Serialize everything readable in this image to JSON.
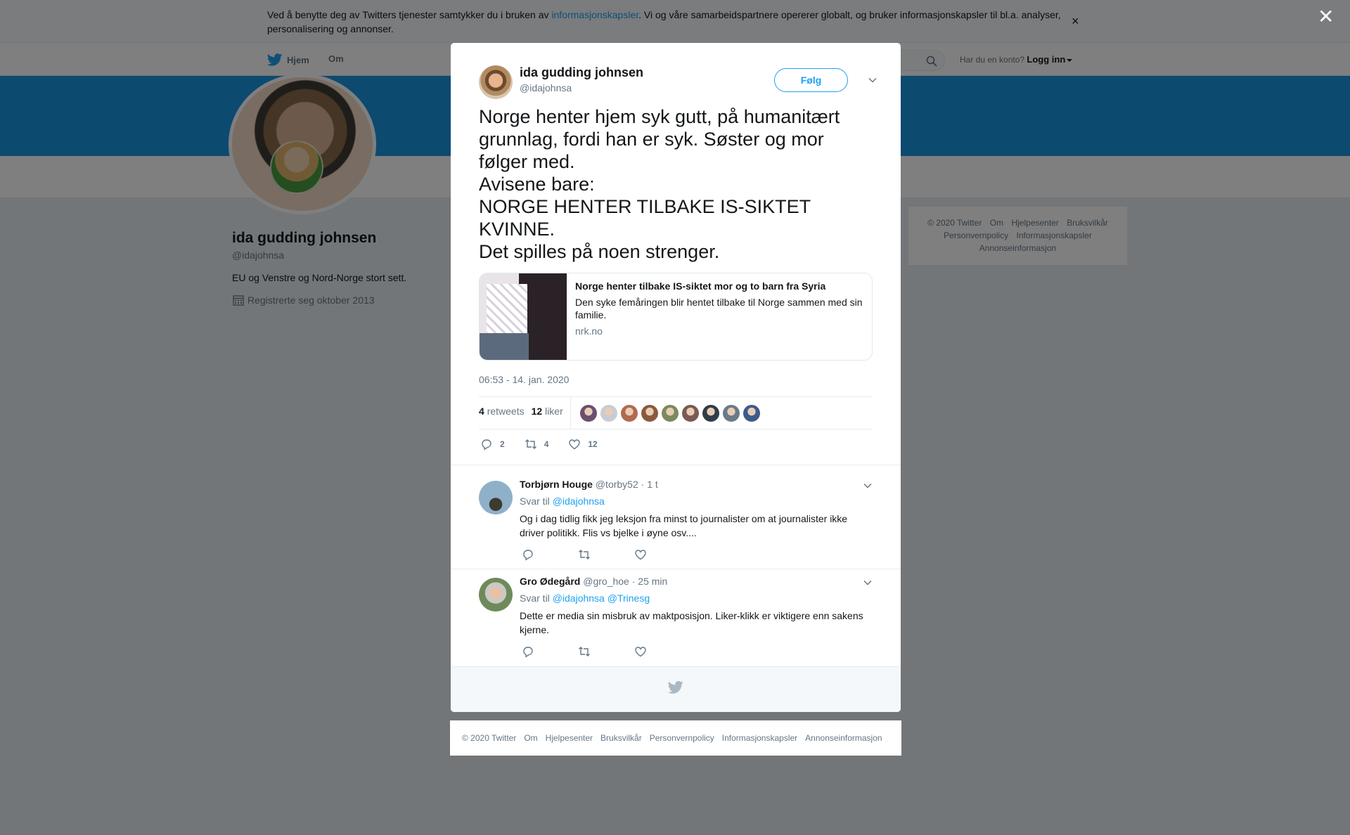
{
  "cookie_bar": {
    "text_before": "Ved å benytte deg av Twitters tjenester samtykker du i bruken av ",
    "link": "informasjonskapsler",
    "text_after": ". Vi og våre samarbeidspartnere opererer globalt, og bruker informasjonskapsler til bl.a. analyser, personalisering og annonser.",
    "close_glyph": "×"
  },
  "navbar": {
    "home_label": "Hjem",
    "about_label": "Om",
    "account_prompt": "Har du en konto?",
    "login_label": "Logg inn"
  },
  "profile": {
    "name": "ida gudding johnsen",
    "handle": "@idajohnsa",
    "bio": "EU og Venstre og Nord-Norge stort sett.",
    "joined": "Registrerte seg oktober 2013"
  },
  "side_footer": {
    "links": [
      "© 2020 Twitter",
      "Om",
      "Hjelpesenter",
      "Bruksvilkår",
      "Personvernpolicy",
      "Informasjonskapsler",
      "Annonseinformasjon"
    ]
  },
  "overlay_close_glyph": "✕",
  "tweet": {
    "author_name": "ida gudding johnsen",
    "author_handle": "@idajohnsa",
    "follow_label": "Følg",
    "text_lines": [
      "Norge henter hjem syk gutt, på humanitært",
      "grunnlag, fordi han er syk. Søster og mor",
      "følger med.",
      "Avisene bare:",
      "NORGE HENTER TILBAKE IS-SIKTET",
      "KVINNE.",
      "Det spilles på noen strenger."
    ],
    "card": {
      "title": "Norge henter tilbake IS-siktet mor og to barn fra Syria",
      "description": "Den syke femåringen blir hentet tilbake til Norge sammen med sin familie.",
      "domain": "nrk.no"
    },
    "timestamp": "06:53 - 14. jan. 2020",
    "retweets_count": "4",
    "retweets_label": "retweets",
    "likes_count": "12",
    "likes_label": "liker",
    "liker_avatar_colors": [
      "#6b4f6f",
      "#c9ccd2",
      "#b06a4e",
      "#8a5a3c",
      "#7c8a5c",
      "#7a5a52",
      "#2f3d4a",
      "#6a7a88",
      "#3c5a8a"
    ],
    "action_counts": {
      "replies": "2",
      "retweets": "4",
      "likes": "12"
    }
  },
  "replies": [
    {
      "name": "Torbjørn Houge",
      "handle": "@torby52",
      "time": "· 1 t",
      "reply_to_label": "Svar til",
      "reply_to": [
        "@idajohnsa"
      ],
      "text": "Og i dag tidlig fikk jeg leksjon fra minst to journalister om at journalister ikke driver politikk. Flis vs bjelke i øyne osv....",
      "avatar_color": "#5a84b0"
    },
    {
      "name": "Gro Ødegård",
      "handle": "@gro_hoe",
      "time": "· 25 min",
      "reply_to_label": "Svar til",
      "reply_to": [
        "@idajohnsa",
        "@Trinesg"
      ],
      "text": "Dette er media sin misbruk av maktposisjon. Liker-klikk er viktigere enn sakens kjerne.",
      "avatar_color": "#6f8a5a"
    }
  ],
  "bottom_footer": {
    "links": [
      "© 2020 Twitter",
      "Om",
      "Hjelpesenter",
      "Bruksvilkår",
      "Personvernpolicy",
      "Informasjonskapsler",
      "Annonseinformasjon"
    ]
  },
  "colors": {
    "brand_blue": "#1da1f2",
    "banner_blue": "#1b95e0",
    "muted_text": "#657786"
  }
}
